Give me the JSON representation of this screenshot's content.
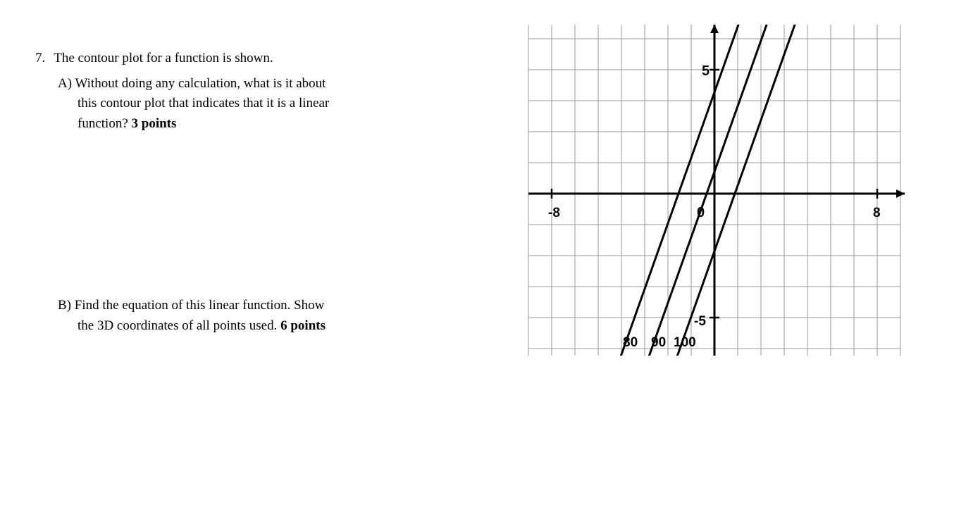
{
  "question": {
    "number": "7.",
    "intro": "The contour plot for a function is shown.",
    "partA": {
      "label": "A)",
      "line1": "Without doing any calculation, what is it about",
      "line2": "this contour plot that indicates that it is a linear",
      "line3": "function?",
      "points": "3 points"
    },
    "partB": {
      "label": "B)",
      "line1": "Find the equation of this linear function. Show",
      "line2": "the 3D coordinates of all points used.",
      "points": "6 points"
    }
  },
  "graph": {
    "axisLabels": {
      "xMin": "-8",
      "xMax": "8",
      "yMax": "5",
      "yMin": "-5",
      "origin": "0"
    },
    "contourLabels": [
      "80",
      "90",
      "100"
    ]
  },
  "chart_data": {
    "type": "contour",
    "title": "Contour plot",
    "xlabel": "",
    "ylabel": "",
    "xlim": [
      -8,
      8
    ],
    "ylim": [
      -5,
      5
    ],
    "contours": [
      {
        "level": 80,
        "line_passes_through": [
          {
            "x": -4,
            "y": -6
          },
          {
            "x": 0,
            "y": 6
          }
        ],
        "slope": 3
      },
      {
        "level": 90,
        "line_passes_through": [
          {
            "x": -3,
            "y": -6
          },
          {
            "x": 1,
            "y": 6
          }
        ],
        "slope": 3
      },
      {
        "level": 100,
        "line_passes_through": [
          {
            "x": -2,
            "y": -6
          },
          {
            "x": 2,
            "y": 6
          }
        ],
        "slope": 3
      }
    ],
    "note": "Contour lines are parallel, equally spaced straight lines indicating a linear function of two variables."
  }
}
